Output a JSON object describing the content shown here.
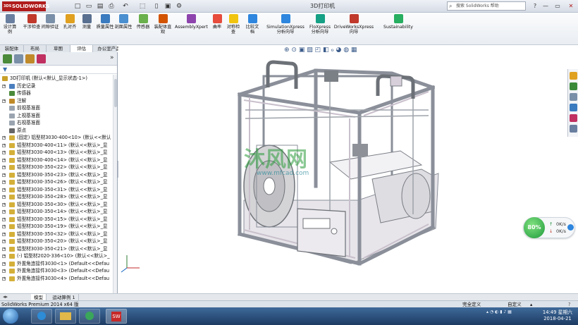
{
  "app": {
    "logo": "SOLIDWORKS",
    "document_title": "3D打印机"
  },
  "quick_access": [
    "□",
    "▭",
    "▤",
    "⎙",
    "↶",
    "⬚",
    "▯",
    "▣",
    "⚙"
  ],
  "search": {
    "placeholder": "搜索 SolidWorks 帮助"
  },
  "window_controls": [
    "?",
    "—",
    "▭",
    "✕"
  ],
  "toolbar": [
    {
      "label": "设计算例",
      "icon": "study-icon",
      "color": "#6a7fa0"
    },
    {
      "label": "干涉检查",
      "icon": "interference-icon",
      "color": "#c0392b"
    },
    {
      "label": "间隙验证",
      "icon": "clearance-icon",
      "color": "#7a8fa8"
    },
    {
      "label": "孔对齐",
      "icon": "hole-align-icon",
      "color": "#e0a020"
    },
    {
      "label": "测量",
      "icon": "measure-icon",
      "color": "#5a7090"
    },
    {
      "label": "质量属性",
      "icon": "mass-icon",
      "color": "#3b7bbf"
    },
    {
      "label": "剖面属性",
      "icon": "section-icon",
      "color": "#4a8fd0"
    },
    {
      "label": "传感器",
      "icon": "sensor-icon",
      "color": "#6ab04c"
    },
    {
      "label": "装配体直观",
      "icon": "asm-visual-icon",
      "color": "#d35400"
    },
    {
      "label": "AssemblyXpert",
      "icon": "asm-xpert-icon",
      "color": "#8e44ad"
    },
    {
      "label": "曲率",
      "icon": "curvature-icon",
      "color": "#e74c3c"
    },
    {
      "label": "对称检查",
      "icon": "symmetry-icon",
      "color": "#f1c40f"
    },
    {
      "label": "比较文档",
      "icon": "compare-icon",
      "color": "#2e86de"
    },
    {
      "label": "SimulationXpress 分析向导",
      "icon": "simulation-icon",
      "color": "#2e86de"
    },
    {
      "label": "FloXpress 分析向导",
      "icon": "flo-icon",
      "color": "#16a085"
    },
    {
      "label": "DriveWorksXpress 向导",
      "icon": "driveworks-icon",
      "color": "#c0392b"
    },
    {
      "label": "Sustainability",
      "icon": "sustainability-icon",
      "color": "#27ae60"
    }
  ],
  "tabs": [
    "装配体",
    "布局",
    "草图",
    "评估",
    "办公室产品"
  ],
  "active_tab": "评估",
  "tree": [
    {
      "label": "3D打印机 (默认<默认_显示状态-1>)",
      "icon": "assembly-icon",
      "level": 0,
      "expander": false
    },
    {
      "label": "历史记录",
      "icon": "history-icon",
      "level": 1,
      "expander": true
    },
    {
      "label": "传感器",
      "icon": "sensor-icon",
      "level": 1,
      "expander": false
    },
    {
      "label": "注解",
      "icon": "annotation-icon",
      "level": 1,
      "expander": true
    },
    {
      "label": "前视基准面",
      "icon": "plane-icon",
      "level": 1,
      "expander": false
    },
    {
      "label": "上视基准面",
      "icon": "plane-icon",
      "level": 1,
      "expander": false
    },
    {
      "label": "右视基准面",
      "icon": "plane-icon",
      "level": 1,
      "expander": false
    },
    {
      "label": "原点",
      "icon": "origin-icon",
      "level": 1,
      "expander": false
    },
    {
      "label": "(固定) 铝型材3030-400<10> (默认<<默认",
      "icon": "part-icon",
      "level": 1,
      "expander": true
    },
    {
      "label": "铝型材3030-400<11> (默认<<默认>_显",
      "icon": "part-icon",
      "level": 1,
      "expander": true
    },
    {
      "label": "铝型材3030-400<13> (默认<<默认>_显",
      "icon": "part-icon",
      "level": 1,
      "expander": true
    },
    {
      "label": "铝型材3030-400<14> (默认<<默认>_显",
      "icon": "part-icon",
      "level": 1,
      "expander": true
    },
    {
      "label": "铝型材3030-350<22> (默认<<默认>_显",
      "icon": "part-icon",
      "level": 1,
      "expander": true
    },
    {
      "label": "铝型材3030-350<23> (默认<<默认>_显",
      "icon": "part-icon",
      "level": 1,
      "expander": true
    },
    {
      "label": "铝型材3030-350<26> (默认<<默认>_显",
      "icon": "part-icon",
      "level": 1,
      "expander": true
    },
    {
      "label": "铝型材3030-350<31> (默认<<默认>_显",
      "icon": "part-icon",
      "level": 1,
      "expander": true
    },
    {
      "label": "铝型材3030-350<28> (默认<<默认>_显",
      "icon": "part-icon",
      "level": 1,
      "expander": true
    },
    {
      "label": "铝型材3030-350<30> (默认<<默认>_显",
      "icon": "part-icon",
      "level": 1,
      "expander": true
    },
    {
      "label": "铝型材3030-350<14> (默认<<默认>_显",
      "icon": "part-icon",
      "level": 1,
      "expander": true
    },
    {
      "label": "铝型材3030-350<15> (默认<<默认>_显",
      "icon": "part-icon",
      "level": 1,
      "expander": true
    },
    {
      "label": "铝型材3030-350<19> (默认<<默认>_显",
      "icon": "part-icon",
      "level": 1,
      "expander": true
    },
    {
      "label": "铝型材3030-350<32> (默认<<默认>_显",
      "icon": "part-icon",
      "level": 1,
      "expander": true
    },
    {
      "label": "铝型材3030-350<20> (默认<<默认>_显",
      "icon": "part-icon",
      "level": 1,
      "expander": true
    },
    {
      "label": "铝型材3030-350<21> (默认<<默认>_显",
      "icon": "part-icon",
      "level": 1,
      "expander": true
    },
    {
      "label": "(-) 铝型材2020-336<10> (默认<<默认>_",
      "icon": "part-icon",
      "level": 1,
      "expander": true
    },
    {
      "label": "外置角连接件3030<1> (Default<<Defau",
      "icon": "part-icon",
      "level": 1,
      "expander": true
    },
    {
      "label": "外置角连接件3030<3> (Default<<Defau",
      "icon": "part-icon",
      "level": 1,
      "expander": true
    },
    {
      "label": "外置角连接件3030<4> (Default<<Defau",
      "icon": "part-icon",
      "level": 1,
      "expander": true
    }
  ],
  "watermark": {
    "main": "沐风网",
    "url": "www.mfcad.com"
  },
  "network_widget": {
    "percent": "80%",
    "up": "0K/s",
    "down": "0K/s"
  },
  "bottom_tabs": [
    "模型",
    "运动算例 1"
  ],
  "status": {
    "left": "SolidWorks Premium 2014 x64 版",
    "mode": "完全定义",
    "unit": "自定义"
  },
  "clock": {
    "time": "14:49 星期六",
    "date": "2018-04-21"
  },
  "colors": {
    "frame": "#8a8f99",
    "rail": "#c9c0cc",
    "accent": "#b01c1c",
    "taskbar": "#1d3b63"
  }
}
